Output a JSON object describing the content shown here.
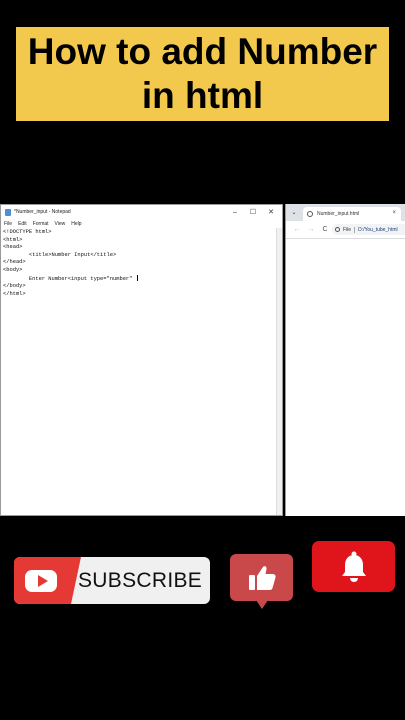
{
  "banner": {
    "line1": "How to add Number",
    "line2": "in html",
    "background": "#f2c94c"
  },
  "notepad": {
    "title": "*Number_input - Notepad",
    "controls": [
      "–",
      "☐",
      "✕"
    ],
    "menu": [
      "File",
      "Edit",
      "Format",
      "View",
      "Help"
    ],
    "lines": [
      "<!DOCTYPE html>",
      "<html>",
      "<head>",
      "        <title>Number Input</title>",
      "</head>",
      "",
      "<body>",
      "        Enter Number<input type=\"number\" ",
      "</body>",
      "</html>"
    ]
  },
  "browser": {
    "tab_title": "Number_input.html",
    "tab_close": "×",
    "back": "←",
    "forward": "→",
    "reload": "C",
    "file_chip": "File",
    "url": "D:/You_tube_html"
  },
  "cta": {
    "subscribe_label": "SUBSCRIBE",
    "subscribe_red": "#e53935",
    "like_color": "#c9484a",
    "bell_color": "#e0141b"
  },
  "icons": {
    "youtube": "youtube-logo-icon",
    "like": "thumbs-up-icon",
    "bell": "bell-icon"
  }
}
